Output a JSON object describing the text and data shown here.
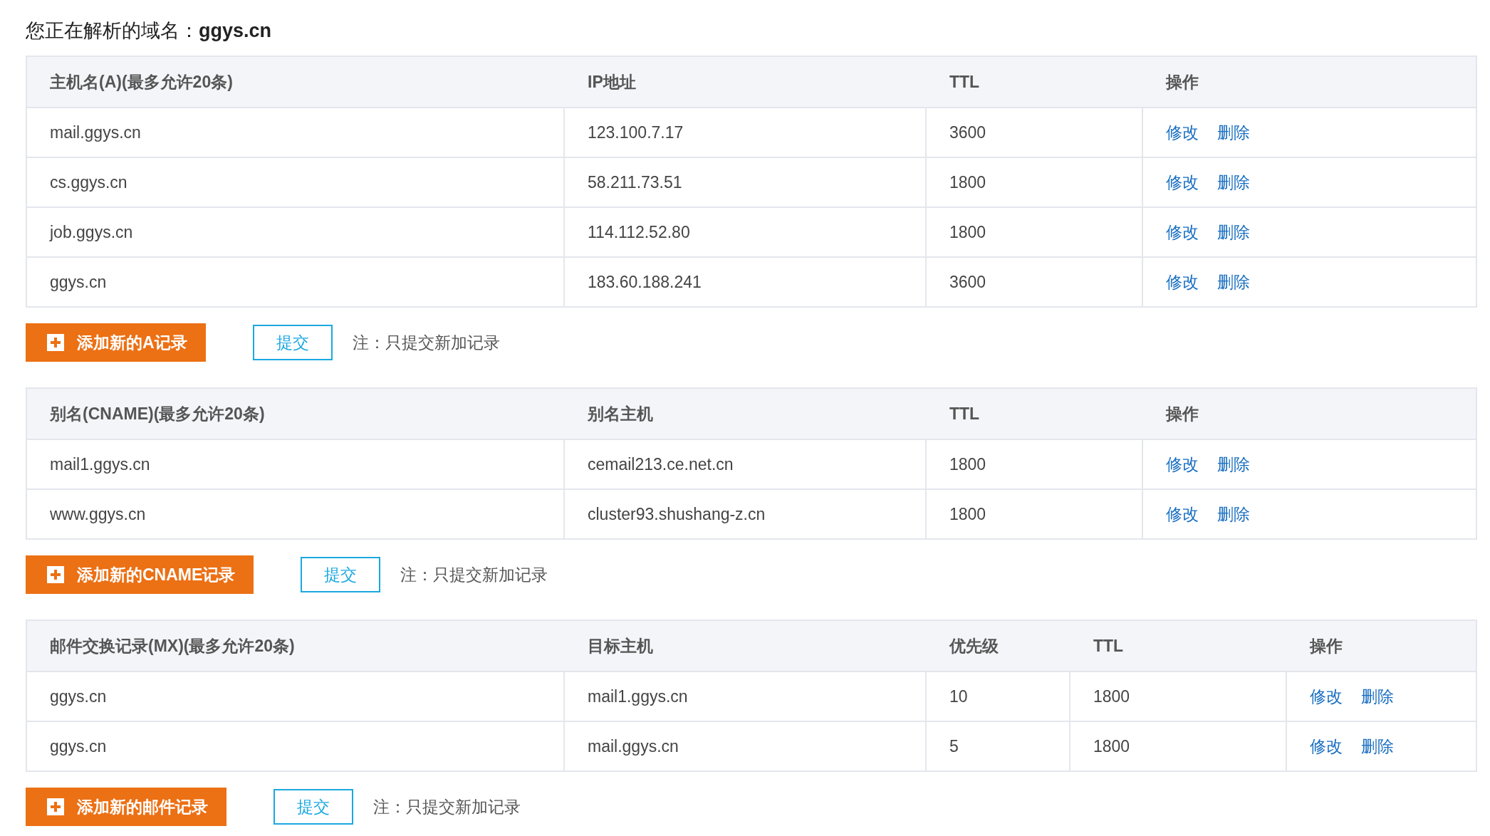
{
  "title": {
    "label": "您正在解析的域名：",
    "domain": "ggys.cn"
  },
  "sections": [
    {
      "kind": "a",
      "columns": [
        "主机名(A)(最多允许20条)",
        "IP地址",
        "TTL",
        "操作"
      ],
      "rows": [
        {
          "cells": [
            "mail.ggys.cn",
            "123.100.7.17",
            "3600"
          ],
          "actions": [
            "修改",
            "删除"
          ]
        },
        {
          "cells": [
            "cs.ggys.cn",
            "58.211.73.51",
            "1800"
          ],
          "actions": [
            "修改",
            "删除"
          ]
        },
        {
          "cells": [
            "job.ggys.cn",
            "114.112.52.80",
            "1800"
          ],
          "actions": [
            "修改",
            "删除"
          ]
        },
        {
          "cells": [
            "ggys.cn",
            "183.60.188.241",
            "3600"
          ],
          "actions": [
            "修改",
            "删除"
          ]
        }
      ],
      "add_button": "添加新的A记录",
      "submit_button": "提交",
      "note": "注：只提交新加记录"
    },
    {
      "kind": "cname",
      "columns": [
        "别名(CNAME)(最多允许20条)",
        "别名主机",
        "TTL",
        "操作"
      ],
      "rows": [
        {
          "cells": [
            "mail1.ggys.cn",
            "cemail213.ce.net.cn",
            "1800"
          ],
          "actions": [
            "修改",
            "删除"
          ]
        },
        {
          "cells": [
            "www.ggys.cn",
            "cluster93.shushang-z.cn",
            "1800"
          ],
          "actions": [
            "修改",
            "删除"
          ]
        }
      ],
      "add_button": "添加新的CNAME记录",
      "submit_button": "提交",
      "note": "注：只提交新加记录"
    },
    {
      "kind": "mx",
      "columns": [
        "邮件交换记录(MX)(最多允许20条)",
        "目标主机",
        "优先级",
        "TTL",
        "操作"
      ],
      "rows": [
        {
          "cells": [
            "ggys.cn",
            "mail1.ggys.cn",
            "10",
            "1800"
          ],
          "actions": [
            "修改",
            "删除"
          ]
        },
        {
          "cells": [
            "ggys.cn",
            "mail.ggys.cn",
            "5",
            "1800"
          ],
          "actions": [
            "修改",
            "删除"
          ]
        }
      ],
      "add_button": "添加新的邮件记录",
      "submit_button": "提交",
      "note": "注：只提交新加记录"
    }
  ]
}
